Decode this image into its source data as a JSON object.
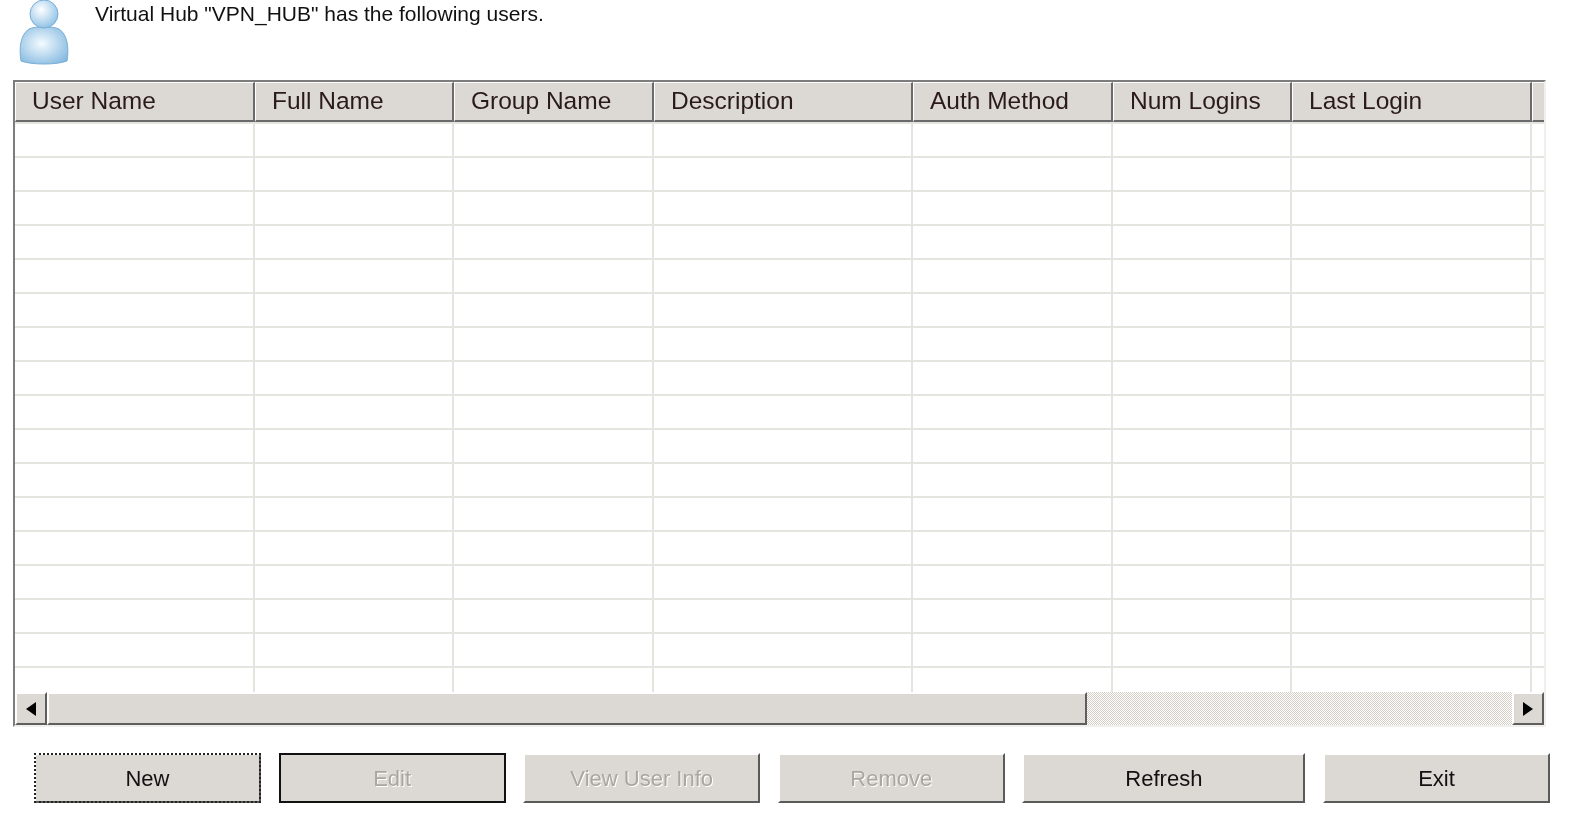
{
  "header": {
    "message": "Virtual Hub \"VPN_HUB\" has the following users."
  },
  "table": {
    "columns": [
      "User Name",
      "Full Name",
      "Group Name",
      "Description",
      "Auth Method",
      "Num Logins",
      "Last Login"
    ]
  },
  "buttons": [
    {
      "label": "New",
      "disabled": false,
      "focused": true,
      "default": false
    },
    {
      "label": "Edit",
      "disabled": true,
      "focused": false,
      "default": true
    },
    {
      "label": "View User Info",
      "disabled": true,
      "focused": false,
      "default": false
    },
    {
      "label": "Remove",
      "disabled": true,
      "focused": false,
      "default": false
    },
    {
      "label": "Refresh",
      "disabled": false,
      "focused": false,
      "default": false
    },
    {
      "label": "Exit",
      "disabled": false,
      "focused": false,
      "default": false
    }
  ]
}
